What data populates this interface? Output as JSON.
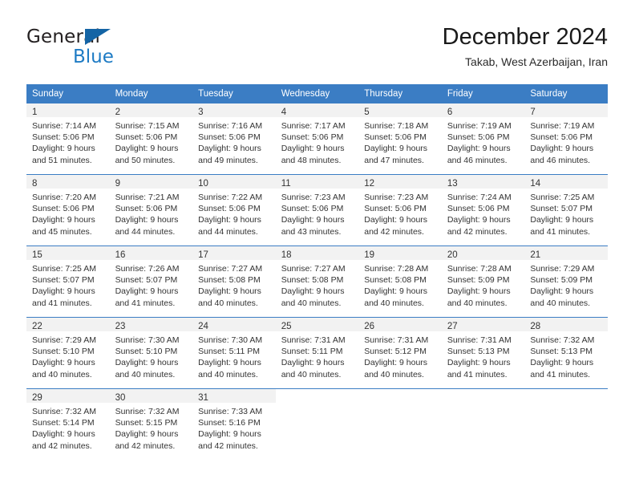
{
  "brand": {
    "line1": "General",
    "line2": "Blue",
    "triangle_color": "#1464a5",
    "blue_text_color": "#1e7bc4"
  },
  "header": {
    "title": "December 2024",
    "subtitle": "Takab, West Azerbaijan, Iran"
  },
  "theme": {
    "header_row_bg": "#3b7dc4",
    "header_row_text": "#ffffff",
    "daynum_band_bg": "#f2f2f2",
    "cell_border": "#3b7dc4",
    "body_text": "#333333"
  },
  "weekdays": [
    "Sunday",
    "Monday",
    "Tuesday",
    "Wednesday",
    "Thursday",
    "Friday",
    "Saturday"
  ],
  "weeks": [
    [
      {
        "day": "1",
        "sunrise": "Sunrise: 7:14 AM",
        "sunset": "Sunset: 5:06 PM",
        "daylight1": "Daylight: 9 hours",
        "daylight2": "and 51 minutes."
      },
      {
        "day": "2",
        "sunrise": "Sunrise: 7:15 AM",
        "sunset": "Sunset: 5:06 PM",
        "daylight1": "Daylight: 9 hours",
        "daylight2": "and 50 minutes."
      },
      {
        "day": "3",
        "sunrise": "Sunrise: 7:16 AM",
        "sunset": "Sunset: 5:06 PM",
        "daylight1": "Daylight: 9 hours",
        "daylight2": "and 49 minutes."
      },
      {
        "day": "4",
        "sunrise": "Sunrise: 7:17 AM",
        "sunset": "Sunset: 5:06 PM",
        "daylight1": "Daylight: 9 hours",
        "daylight2": "and 48 minutes."
      },
      {
        "day": "5",
        "sunrise": "Sunrise: 7:18 AM",
        "sunset": "Sunset: 5:06 PM",
        "daylight1": "Daylight: 9 hours",
        "daylight2": "and 47 minutes."
      },
      {
        "day": "6",
        "sunrise": "Sunrise: 7:19 AM",
        "sunset": "Sunset: 5:06 PM",
        "daylight1": "Daylight: 9 hours",
        "daylight2": "and 46 minutes."
      },
      {
        "day": "7",
        "sunrise": "Sunrise: 7:19 AM",
        "sunset": "Sunset: 5:06 PM",
        "daylight1": "Daylight: 9 hours",
        "daylight2": "and 46 minutes."
      }
    ],
    [
      {
        "day": "8",
        "sunrise": "Sunrise: 7:20 AM",
        "sunset": "Sunset: 5:06 PM",
        "daylight1": "Daylight: 9 hours",
        "daylight2": "and 45 minutes."
      },
      {
        "day": "9",
        "sunrise": "Sunrise: 7:21 AM",
        "sunset": "Sunset: 5:06 PM",
        "daylight1": "Daylight: 9 hours",
        "daylight2": "and 44 minutes."
      },
      {
        "day": "10",
        "sunrise": "Sunrise: 7:22 AM",
        "sunset": "Sunset: 5:06 PM",
        "daylight1": "Daylight: 9 hours",
        "daylight2": "and 44 minutes."
      },
      {
        "day": "11",
        "sunrise": "Sunrise: 7:23 AM",
        "sunset": "Sunset: 5:06 PM",
        "daylight1": "Daylight: 9 hours",
        "daylight2": "and 43 minutes."
      },
      {
        "day": "12",
        "sunrise": "Sunrise: 7:23 AM",
        "sunset": "Sunset: 5:06 PM",
        "daylight1": "Daylight: 9 hours",
        "daylight2": "and 42 minutes."
      },
      {
        "day": "13",
        "sunrise": "Sunrise: 7:24 AM",
        "sunset": "Sunset: 5:06 PM",
        "daylight1": "Daylight: 9 hours",
        "daylight2": "and 42 minutes."
      },
      {
        "day": "14",
        "sunrise": "Sunrise: 7:25 AM",
        "sunset": "Sunset: 5:07 PM",
        "daylight1": "Daylight: 9 hours",
        "daylight2": "and 41 minutes."
      }
    ],
    [
      {
        "day": "15",
        "sunrise": "Sunrise: 7:25 AM",
        "sunset": "Sunset: 5:07 PM",
        "daylight1": "Daylight: 9 hours",
        "daylight2": "and 41 minutes."
      },
      {
        "day": "16",
        "sunrise": "Sunrise: 7:26 AM",
        "sunset": "Sunset: 5:07 PM",
        "daylight1": "Daylight: 9 hours",
        "daylight2": "and 41 minutes."
      },
      {
        "day": "17",
        "sunrise": "Sunrise: 7:27 AM",
        "sunset": "Sunset: 5:08 PM",
        "daylight1": "Daylight: 9 hours",
        "daylight2": "and 40 minutes."
      },
      {
        "day": "18",
        "sunrise": "Sunrise: 7:27 AM",
        "sunset": "Sunset: 5:08 PM",
        "daylight1": "Daylight: 9 hours",
        "daylight2": "and 40 minutes."
      },
      {
        "day": "19",
        "sunrise": "Sunrise: 7:28 AM",
        "sunset": "Sunset: 5:08 PM",
        "daylight1": "Daylight: 9 hours",
        "daylight2": "and 40 minutes."
      },
      {
        "day": "20",
        "sunrise": "Sunrise: 7:28 AM",
        "sunset": "Sunset: 5:09 PM",
        "daylight1": "Daylight: 9 hours",
        "daylight2": "and 40 minutes."
      },
      {
        "day": "21",
        "sunrise": "Sunrise: 7:29 AM",
        "sunset": "Sunset: 5:09 PM",
        "daylight1": "Daylight: 9 hours",
        "daylight2": "and 40 minutes."
      }
    ],
    [
      {
        "day": "22",
        "sunrise": "Sunrise: 7:29 AM",
        "sunset": "Sunset: 5:10 PM",
        "daylight1": "Daylight: 9 hours",
        "daylight2": "and 40 minutes."
      },
      {
        "day": "23",
        "sunrise": "Sunrise: 7:30 AM",
        "sunset": "Sunset: 5:10 PM",
        "daylight1": "Daylight: 9 hours",
        "daylight2": "and 40 minutes."
      },
      {
        "day": "24",
        "sunrise": "Sunrise: 7:30 AM",
        "sunset": "Sunset: 5:11 PM",
        "daylight1": "Daylight: 9 hours",
        "daylight2": "and 40 minutes."
      },
      {
        "day": "25",
        "sunrise": "Sunrise: 7:31 AM",
        "sunset": "Sunset: 5:11 PM",
        "daylight1": "Daylight: 9 hours",
        "daylight2": "and 40 minutes."
      },
      {
        "day": "26",
        "sunrise": "Sunrise: 7:31 AM",
        "sunset": "Sunset: 5:12 PM",
        "daylight1": "Daylight: 9 hours",
        "daylight2": "and 40 minutes."
      },
      {
        "day": "27",
        "sunrise": "Sunrise: 7:31 AM",
        "sunset": "Sunset: 5:13 PM",
        "daylight1": "Daylight: 9 hours",
        "daylight2": "and 41 minutes."
      },
      {
        "day": "28",
        "sunrise": "Sunrise: 7:32 AM",
        "sunset": "Sunset: 5:13 PM",
        "daylight1": "Daylight: 9 hours",
        "daylight2": "and 41 minutes."
      }
    ],
    [
      {
        "day": "29",
        "sunrise": "Sunrise: 7:32 AM",
        "sunset": "Sunset: 5:14 PM",
        "daylight1": "Daylight: 9 hours",
        "daylight2": "and 42 minutes."
      },
      {
        "day": "30",
        "sunrise": "Sunrise: 7:32 AM",
        "sunset": "Sunset: 5:15 PM",
        "daylight1": "Daylight: 9 hours",
        "daylight2": "and 42 minutes."
      },
      {
        "day": "31",
        "sunrise": "Sunrise: 7:33 AM",
        "sunset": "Sunset: 5:16 PM",
        "daylight1": "Daylight: 9 hours",
        "daylight2": "and 42 minutes."
      },
      {
        "day": "",
        "sunrise": "",
        "sunset": "",
        "daylight1": "",
        "daylight2": ""
      },
      {
        "day": "",
        "sunrise": "",
        "sunset": "",
        "daylight1": "",
        "daylight2": ""
      },
      {
        "day": "",
        "sunrise": "",
        "sunset": "",
        "daylight1": "",
        "daylight2": ""
      },
      {
        "day": "",
        "sunrise": "",
        "sunset": "",
        "daylight1": "",
        "daylight2": ""
      }
    ]
  ]
}
